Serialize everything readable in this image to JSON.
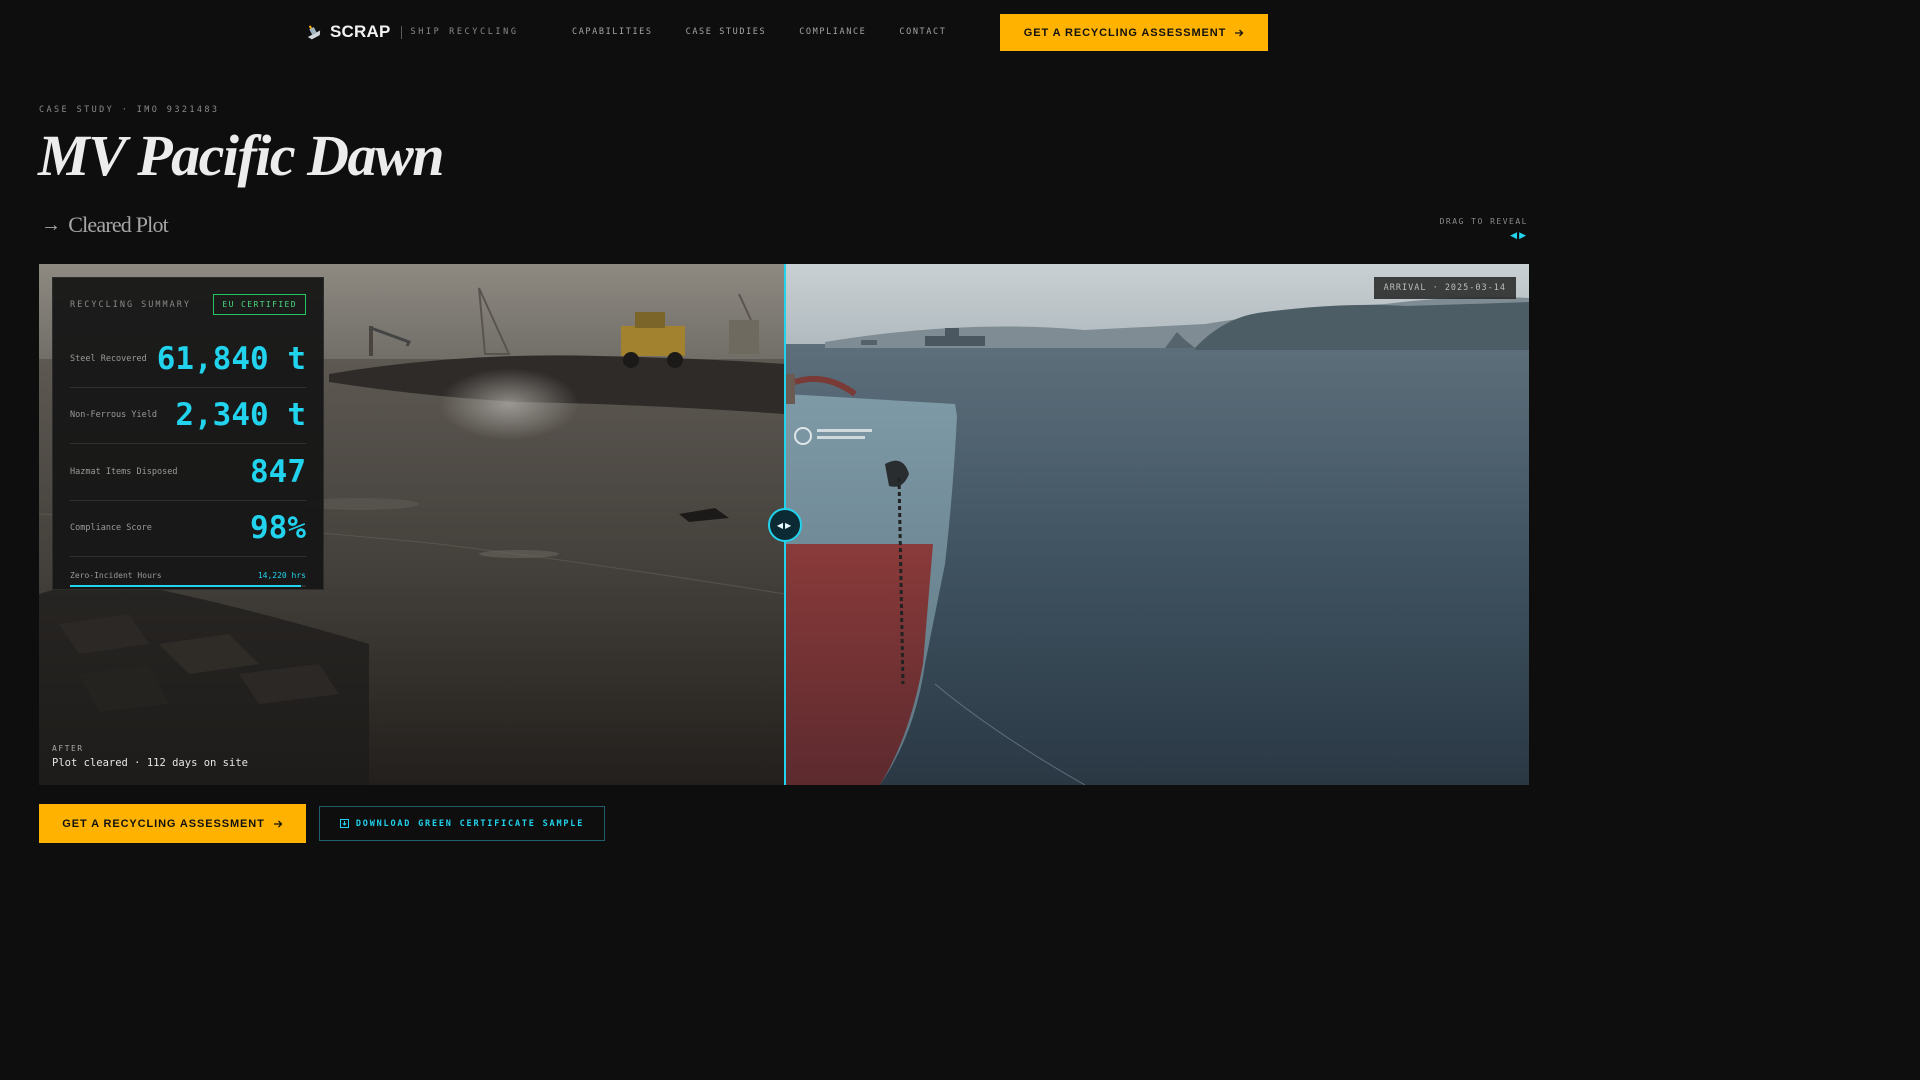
{
  "nav": {
    "logo_text": "SCRAP",
    "logo_subtitle": "SHIP RECYCLING",
    "links": [
      "CAPABILITIES",
      "CASE STUDIES",
      "COMPLIANCE",
      "CONTACT"
    ],
    "cta_label": "GET A RECYCLING ASSESSMENT"
  },
  "header": {
    "eyebrow": "CASE STUDY · IMO 9321483",
    "title": "MV Pacific Dawn",
    "state_label": "Cleared Plot",
    "drag_hint": "DRAG TO REVEAL"
  },
  "compare": {
    "arrival_tag": "ARRIVAL · 2025-03-14",
    "after_tag": "AFTER",
    "after_caption": "Plot cleared · 112 days on site"
  },
  "summary": {
    "title": "RECYCLING SUMMARY",
    "badge": "EU CERTIFIED",
    "stats": [
      {
        "label": "Steel Recovered",
        "value": "61,840 t"
      },
      {
        "label": "Non-Ferrous Yield",
        "value": "2,340 t"
      },
      {
        "label": "Hazmat Items Disposed",
        "value": "847"
      },
      {
        "label": "Compliance Score",
        "value": "98%"
      }
    ],
    "zero_incident": {
      "label": "Zero-Incident Hours",
      "value": "14,220 hrs",
      "progress": 0.98
    }
  },
  "cta": {
    "primary_label": "GET A RECYCLING ASSESSMENT",
    "secondary_label": "DOWNLOAD GREEN CERTIFICATE SAMPLE"
  },
  "colors": {
    "accent_cyan": "#22d3ee",
    "accent_amber": "#ffb300",
    "certified_green": "#22c55e",
    "background": "#0e0e0e"
  },
  "icons": {
    "logo": "ship-icon",
    "cta_arrow": "arrow-right-icon",
    "download": "download-icon",
    "handle": "left-right-arrows-icon"
  }
}
